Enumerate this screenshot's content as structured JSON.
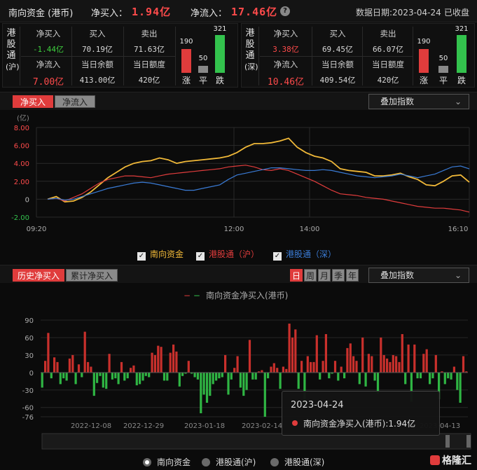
{
  "header": {
    "title": "南向资金 (港币)",
    "net_buy_label": "净买入：",
    "net_buy_value": "1.94亿",
    "net_inflow_label": "净流入：",
    "net_inflow_value": "17.46亿",
    "help_icon": "?",
    "data_date": "数据日期:2023-04-24",
    "status": "已收盘"
  },
  "panels": [
    {
      "name": "港股通(沪)",
      "label_chars": [
        "港",
        "股",
        "通",
        "(沪)"
      ],
      "stats": [
        {
          "k": "净买入",
          "v": "-1.44亿",
          "color": "#3ecf3e"
        },
        {
          "k": "买入",
          "v": "70.19亿",
          "color": "#d8d8d8"
        },
        {
          "k": "卖出",
          "v": "71.63亿",
          "color": "#d8d8d8"
        },
        {
          "k": "净流入",
          "v": "7.00亿",
          "color": "#ff4b4b"
        },
        {
          "k": "当日余额",
          "v": "413.00亿",
          "color": "#d8d8d8"
        },
        {
          "k": "当日额度",
          "v": "420亿",
          "color": "#d8d8d8"
        }
      ],
      "breadth": {
        "up": 190,
        "flat": 50,
        "down": 321,
        "up_label": "涨",
        "flat_label": "平",
        "down_label": "跌"
      }
    },
    {
      "name": "港股通(深)",
      "label_chars": [
        "港",
        "股",
        "通",
        "(深)"
      ],
      "stats": [
        {
          "k": "净买入",
          "v": "3.38亿",
          "color": "#ff4b4b"
        },
        {
          "k": "买入",
          "v": "69.45亿",
          "color": "#d8d8d8"
        },
        {
          "k": "卖出",
          "v": "66.07亿",
          "color": "#d8d8d8"
        },
        {
          "k": "净流入",
          "v": "10.46亿",
          "color": "#ff4b4b"
        },
        {
          "k": "当日余额",
          "v": "409.54亿",
          "color": "#d8d8d8"
        },
        {
          "k": "当日额度",
          "v": "420亿",
          "color": "#d8d8d8"
        }
      ],
      "breadth": {
        "up": 190,
        "flat": 50,
        "down": 321,
        "up_label": "涨",
        "flat_label": "平",
        "down_label": "跌"
      }
    }
  ],
  "intraday": {
    "tabs": [
      "净买入",
      "净流入"
    ],
    "active_tab": 0,
    "overlay_label": "叠加指数",
    "legend": [
      {
        "label": "南向资金",
        "color": "#f0b838"
      },
      {
        "label": "港股通（沪）",
        "color": "#e03c3c"
      },
      {
        "label": "港股通（深）",
        "color": "#3a7bd5"
      }
    ]
  },
  "history": {
    "tabs": [
      "历史净买入",
      "累计净买入"
    ],
    "active_tab": 0,
    "periods": [
      "日",
      "周",
      "月",
      "季",
      "年"
    ],
    "active_period": 0,
    "overlay_label": "叠加指数",
    "legend_label": "南向资金净买入(港币)",
    "tooltip": {
      "date": "2023-04-24",
      "text": "南向资金净买入(港币):1.94亿"
    },
    "radios": [
      "南向资金",
      "港股通(沪)",
      "港股通(深)"
    ],
    "active_radio": 0
  },
  "chart_data": [
    {
      "type": "line",
      "title": "",
      "ylabel": "(亿)",
      "x_ticks": [
        "09:20",
        "12:00",
        "14:00",
        "16:10"
      ],
      "ylim": [
        -2,
        8
      ],
      "y_ticks": [
        "8.00",
        "6.00",
        "4.00",
        "2.00",
        "0",
        "-2.00"
      ],
      "series": [
        {
          "name": "南向资金",
          "color": "#f0b838",
          "values": [
            0.0,
            0.3,
            -0.3,
            -0.2,
            0.2,
            0.8,
            1.6,
            2.4,
            3.0,
            3.6,
            4.0,
            4.2,
            4.3,
            4.6,
            4.4,
            4.0,
            4.2,
            4.3,
            4.4,
            4.5,
            4.6,
            4.8,
            5.2,
            5.8,
            6.2,
            6.2,
            6.3,
            6.5,
            6.8,
            5.8,
            5.2,
            4.8,
            4.6,
            4.2,
            3.4,
            3.2,
            3.1,
            3.0,
            2.6,
            2.6,
            2.7,
            2.9,
            2.5,
            2.2,
            1.6,
            1.5,
            2.0,
            2.6,
            2.7,
            1.9
          ]
        },
        {
          "name": "港股通（沪）",
          "color": "#e03c3c",
          "values": [
            0.0,
            0.1,
            -0.2,
            0.2,
            0.6,
            1.2,
            1.8,
            2.2,
            2.4,
            2.6,
            2.6,
            2.5,
            2.4,
            2.6,
            2.8,
            2.9,
            3.0,
            3.1,
            3.2,
            3.3,
            3.4,
            3.6,
            3.7,
            3.8,
            3.6,
            3.3,
            3.2,
            3.4,
            3.2,
            2.8,
            2.4,
            2.0,
            1.5,
            1.0,
            0.6,
            0.5,
            0.4,
            0.2,
            0.1,
            0.0,
            -0.2,
            -0.4,
            -0.6,
            -0.8,
            -0.9,
            -1.0,
            -1.0,
            -1.1,
            -1.2,
            -1.44
          ]
        },
        {
          "name": "港股通（深）",
          "color": "#3a7bd5",
          "values": [
            0.0,
            0.1,
            -0.1,
            0.0,
            0.3,
            0.6,
            0.9,
            1.2,
            1.4,
            1.6,
            1.8,
            1.9,
            1.8,
            1.6,
            1.4,
            1.2,
            1.0,
            1.0,
            1.2,
            1.4,
            1.6,
            2.2,
            2.7,
            2.9,
            3.1,
            3.3,
            3.5,
            3.5,
            3.4,
            3.3,
            3.2,
            3.2,
            3.3,
            3.2,
            3.0,
            2.8,
            2.6,
            2.5,
            2.4,
            2.5,
            2.6,
            2.8,
            2.6,
            2.4,
            2.6,
            2.8,
            3.2,
            3.6,
            3.7,
            3.38
          ]
        }
      ]
    },
    {
      "type": "bar",
      "title": "南向资金净买入(港币)",
      "ylim": [
        -76,
        90
      ],
      "y_ticks": [
        "90",
        "60",
        "30",
        "0",
        "-30",
        "-60",
        "-76"
      ],
      "x_ticks": [
        "2022-12-08",
        "2022-12-29",
        "2023-01-18",
        "2023-02-14",
        "2023-04-13"
      ],
      "series": [
        {
          "name": "南向资金净买入(港币)",
          "values": [
            -26,
            20,
            68,
            -10,
            26,
            18,
            -20,
            -10,
            -14,
            24,
            30,
            -20,
            14,
            -8,
            70,
            18,
            10,
            -40,
            -18,
            -6,
            -26,
            -28,
            32,
            -12,
            -10,
            -20,
            18,
            -14,
            -10,
            8,
            12,
            -22,
            -20,
            -14,
            -6,
            -8,
            34,
            30,
            46,
            44,
            -14,
            -14,
            34,
            48,
            36,
            -24,
            -6,
            -2,
            20,
            -2,
            -8,
            -12,
            -70,
            -38,
            -52,
            -40,
            -20,
            -14,
            -10,
            -8,
            30,
            -38,
            -12,
            8,
            28,
            -26,
            -40,
            -30,
            56,
            -12,
            -12,
            2,
            4,
            -76,
            -10,
            10,
            16,
            8,
            -28,
            10,
            6,
            84,
            60,
            74,
            -28,
            20,
            -52,
            28,
            18,
            18,
            64,
            -12,
            20,
            66,
            -10,
            -2,
            20,
            -14,
            10,
            -10,
            42,
            50,
            28,
            20,
            -20,
            60,
            -24,
            32,
            28,
            -14,
            -36,
            60,
            30,
            24,
            18,
            30,
            28,
            18,
            66,
            -20,
            48,
            -50,
            48,
            -10,
            -10,
            32,
            40,
            -20,
            -10,
            30,
            -46,
            2,
            -20,
            -10,
            -12,
            10,
            -30,
            -52,
            28,
            1.94
          ]
        }
      ]
    }
  ],
  "brand": "格隆汇"
}
